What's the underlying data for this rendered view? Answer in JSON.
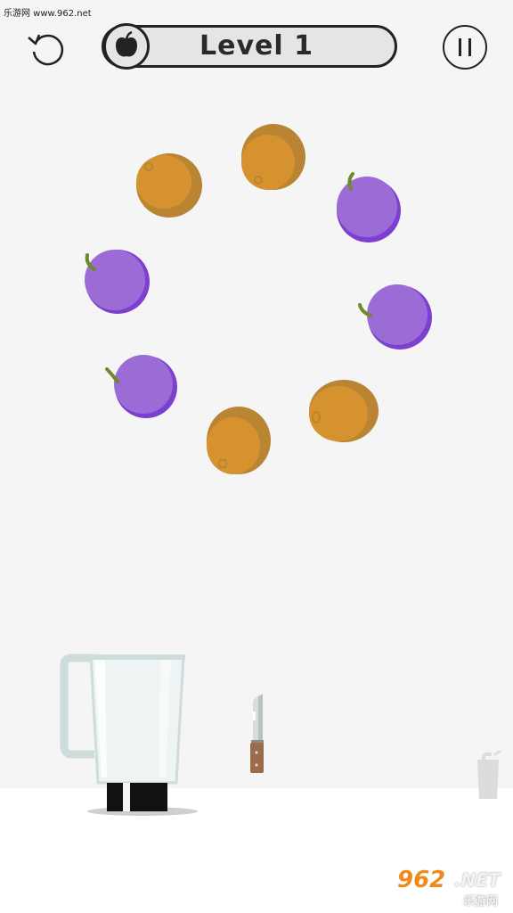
{
  "watermark_top": "乐游网 www.962.net",
  "header": {
    "level_label": "Level 1",
    "restart_icon": "restart-icon",
    "fruit_icon": "apple-icon",
    "pause_icon": "pause-icon"
  },
  "fruits": [
    {
      "kind": "orange"
    },
    {
      "kind": "orange"
    },
    {
      "kind": "plum"
    },
    {
      "kind": "plum"
    },
    {
      "kind": "plum"
    },
    {
      "kind": "plum"
    },
    {
      "kind": "orange"
    },
    {
      "kind": "orange"
    }
  ],
  "items": {
    "blender": "blender-icon",
    "knife": "knife-icon",
    "glass": "glass-icon"
  },
  "watermark_logo": {
    "brand": "962",
    "net": ".NET",
    "sub": "乐游网"
  },
  "colors": {
    "orange": "#d6922f",
    "orange_shade": "#b98533",
    "plum": "#9b6bd6",
    "plum_shade": "#7c3fd0",
    "stem": "#6f8a2a",
    "background": "#f5f5f5",
    "floor": "#ffffff"
  }
}
